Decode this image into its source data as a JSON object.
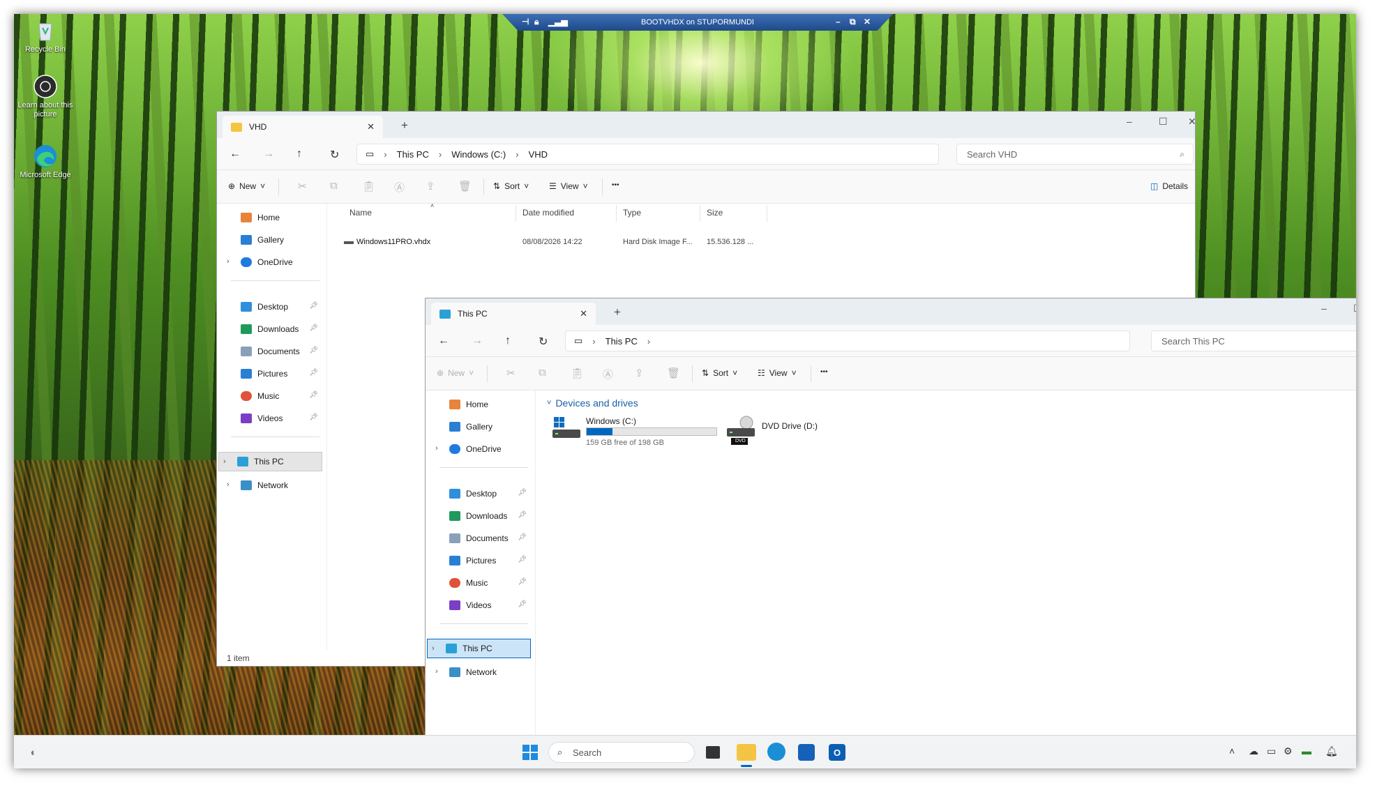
{
  "colors": {
    "accent": "#0067c0",
    "folder": "#f4c542",
    "drive_bar": "#0067c0",
    "taskbar": "#f2f3f5"
  },
  "remote_bar": {
    "title": "BOOTVHDX on STUPORMUNDI"
  },
  "desktop": {
    "icons": [
      {
        "label": "Recycle Bin",
        "icon": "recycle-bin-icon"
      },
      {
        "label": "Learn about this picture",
        "icon": "camera-icon"
      },
      {
        "label": "Microsoft Edge",
        "icon": "edge-icon"
      }
    ]
  },
  "vhd_window": {
    "tab_title": "VHD",
    "path": [
      "This PC",
      "Windows (C:)",
      "VHD"
    ],
    "search_placeholder": "Search VHD",
    "commands": {
      "new": "New",
      "sort": "Sort",
      "view": "View",
      "details": "Details",
      "more": "•••"
    },
    "sidebar": {
      "top": [
        {
          "label": "Home"
        },
        {
          "label": "Gallery"
        },
        {
          "label": "OneDrive"
        }
      ],
      "pinned": [
        {
          "label": "Desktop"
        },
        {
          "label": "Downloads"
        },
        {
          "label": "Documents"
        },
        {
          "label": "Pictures"
        },
        {
          "label": "Music"
        },
        {
          "label": "Videos"
        }
      ],
      "bottom": [
        {
          "label": "This PC"
        },
        {
          "label": "Network"
        }
      ]
    },
    "columns": [
      "Name",
      "Date modified",
      "Type",
      "Size"
    ],
    "rows": [
      {
        "name": "Windows11PRO.vhdx",
        "date": "08/08/2026 14:22",
        "type": "Hard Disk Image F...",
        "size": "15.536.128 ..."
      }
    ],
    "status": "1 item"
  },
  "thispc_window": {
    "tab_title": "This PC",
    "path": [
      "This PC"
    ],
    "search_placeholder": "Search This PC",
    "commands": {
      "new": "New",
      "sort": "Sort",
      "view": "View",
      "more": "•••"
    },
    "sidebar": {
      "top": [
        {
          "label": "Home"
        },
        {
          "label": "Gallery"
        },
        {
          "label": "OneDrive"
        }
      ],
      "pinned": [
        {
          "label": "Desktop"
        },
        {
          "label": "Downloads"
        },
        {
          "label": "Documents"
        },
        {
          "label": "Pictures"
        },
        {
          "label": "Music"
        },
        {
          "label": "Videos"
        }
      ],
      "bottom": [
        {
          "label": "This PC"
        },
        {
          "label": "Network"
        }
      ]
    },
    "section_title": "Devices and drives",
    "drives": [
      {
        "name": "Windows (C:)",
        "free_text": "159 GB free of 198 GB",
        "used_fraction": 0.197
      },
      {
        "name": "DVD Drive (D:)",
        "badge": "DVD"
      }
    ]
  },
  "taskbar": {
    "search_placeholder": "Search",
    "apps": [
      "start-icon",
      "task-view-icon",
      "file-explorer-icon",
      "edge-icon",
      "store-icon",
      "outlook-icon"
    ]
  }
}
